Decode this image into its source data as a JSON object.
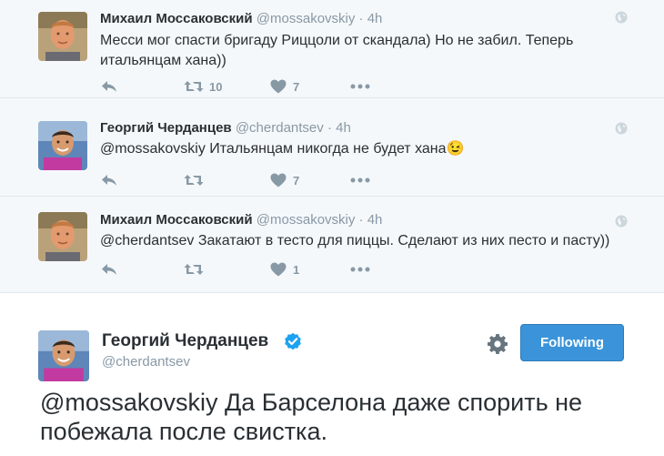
{
  "replies": [
    {
      "name": "Михаил Моссаковский",
      "handle": "@mossakovskiy",
      "dot": "·",
      "time": "4h",
      "text": "Месси мог спасти бригаду Риццоли от скандала) Но не забил. Теперь итальянцам хана))",
      "retweets": "10",
      "likes": "7",
      "avatar": "avatar-mikhail"
    },
    {
      "name": "Георгий Черданцев",
      "handle": "@cherdantsev",
      "dot": "·",
      "time": "4h",
      "text": "@mossakovskiy Итальянцам никогда не будет хана",
      "emoji": "😉",
      "retweets": "",
      "likes": "7",
      "avatar": "avatar-georgiy"
    },
    {
      "name": "Михаил Моссаковский",
      "handle": "@mossakovskiy",
      "dot": "·",
      "time": "4h",
      "text": "@cherdantsev Закатают в тесто для пиццы. Сделают из них песто и пасту))",
      "retweets": "",
      "likes": "1",
      "avatar": "avatar-mikhail"
    }
  ],
  "main": {
    "name": "Георгий Черданцев",
    "handle": "@cherdantsev",
    "follow_label": "Following",
    "text": "@mossakovskiy Да Барселона даже спорить не побежала после свистка."
  },
  "colors": {
    "accent": "#3b94d9",
    "muted": "#8899a6",
    "text": "#292f33",
    "reply_bg": "#f5f8fa"
  },
  "icons": [
    "reply-icon",
    "retweet-icon",
    "like-icon",
    "more-icon",
    "globe-icon",
    "verified-icon",
    "gear-icon"
  ]
}
